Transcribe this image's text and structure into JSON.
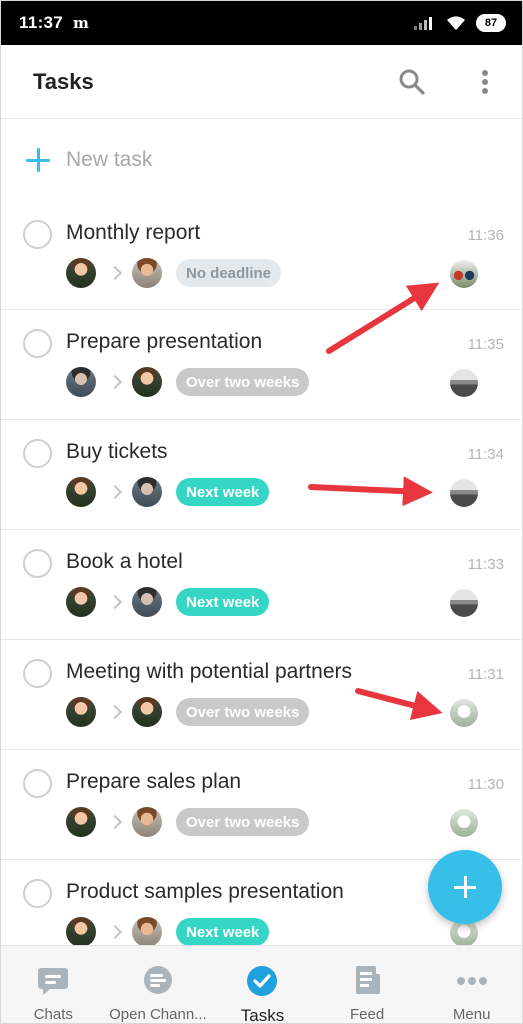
{
  "status_bar": {
    "time": "11:37",
    "carrier_glyph": "m",
    "battery": "87"
  },
  "header": {
    "title": "Tasks",
    "search_icon": "search-icon",
    "more_icon": "more-vertical-icon"
  },
  "new_task": {
    "label": "New task",
    "icon": "plus-icon"
  },
  "tasks": [
    {
      "name": "Monthly report",
      "time": "11:36",
      "badge": "No deadline",
      "badge_style": "gray-light"
    },
    {
      "name": "Prepare presentation",
      "time": "11:35",
      "badge": "Over two weeks",
      "badge_style": "gray"
    },
    {
      "name": "Buy tickets",
      "time": "11:34",
      "badge": "Next week",
      "badge_style": "teal"
    },
    {
      "name": "Book a hotel",
      "time": "11:33",
      "badge": "Next week",
      "badge_style": "teal"
    },
    {
      "name": "Meeting with potential partners",
      "time": "11:31",
      "badge": "Over two weeks",
      "badge_style": "gray"
    },
    {
      "name": "Prepare sales plan",
      "time": "11:30",
      "badge": "Over two weeks",
      "badge_style": "gray"
    },
    {
      "name": "Product samples presentation",
      "time": "",
      "badge": "Next week",
      "badge_style": "teal"
    }
  ],
  "fab": {
    "icon": "plus-icon"
  },
  "bottom_nav": [
    {
      "label": "Chats",
      "icon": "chat-bubble-icon"
    },
    {
      "label": "Open Chann...",
      "icon": "open-channels-icon"
    },
    {
      "label": "Tasks",
      "icon": "check-circle-icon",
      "active": true
    },
    {
      "label": "Feed",
      "icon": "feed-icon"
    },
    {
      "label": "Menu",
      "icon": "more-horizontal-icon"
    }
  ],
  "colors": {
    "accent": "#35bfe9",
    "teal_badge": "#36d6c5",
    "gray_badge": "#c9c9c9",
    "arrow": "#e8363f"
  }
}
